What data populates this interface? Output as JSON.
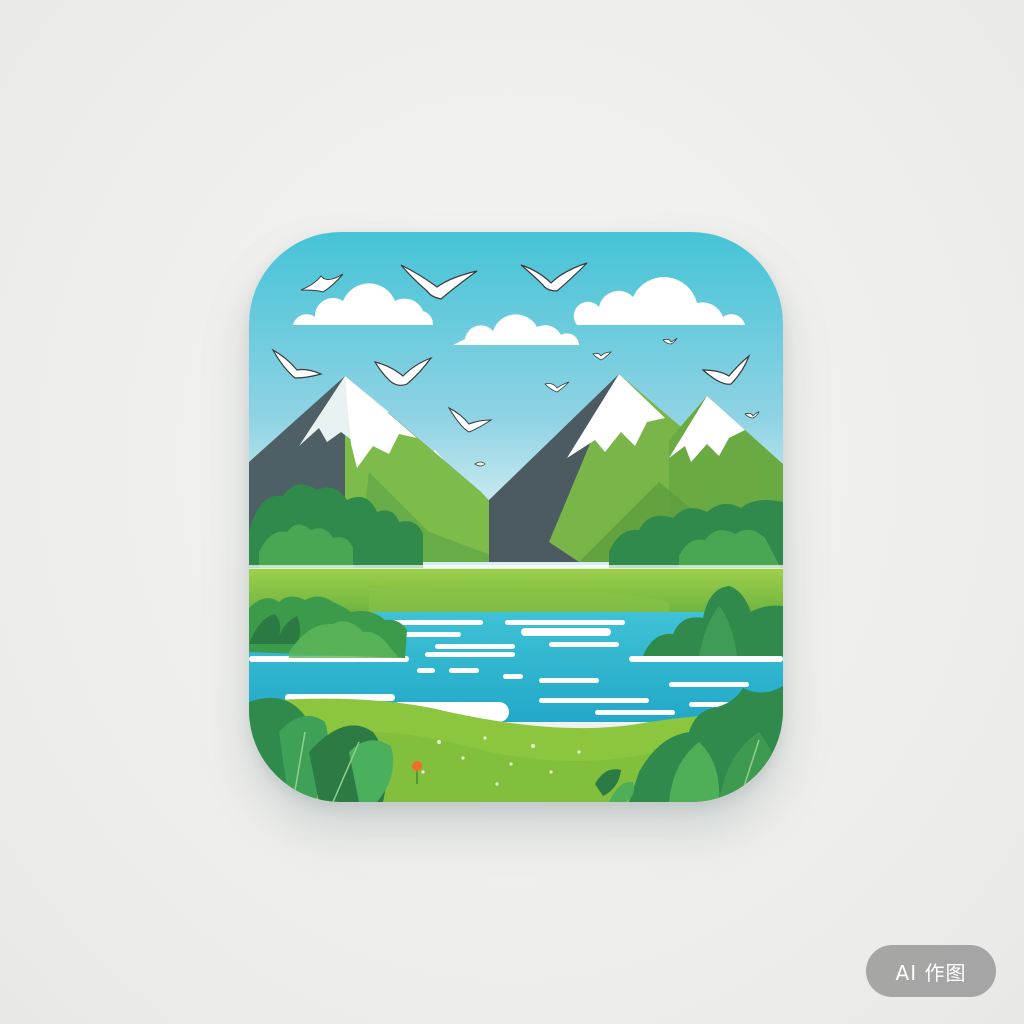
{
  "badge": {
    "label": "AI 作图"
  },
  "icon": {
    "subject": "landscape",
    "colors": {
      "sky_top": "#4cc6d6",
      "sky_bottom": "#cfeaf0",
      "mountain_dark": "#4f5f66",
      "mountain_green": "#7dbb4a",
      "snow": "#ffffff",
      "forest": "#2f8a4c",
      "grass": "#8cc63f",
      "water": "#2cb3cf",
      "flower": "#f26b2a"
    },
    "elements": [
      "cloud-icon",
      "bird-icon",
      "mountain-icon",
      "lake-icon",
      "tree-icon",
      "leaf-icon"
    ]
  }
}
